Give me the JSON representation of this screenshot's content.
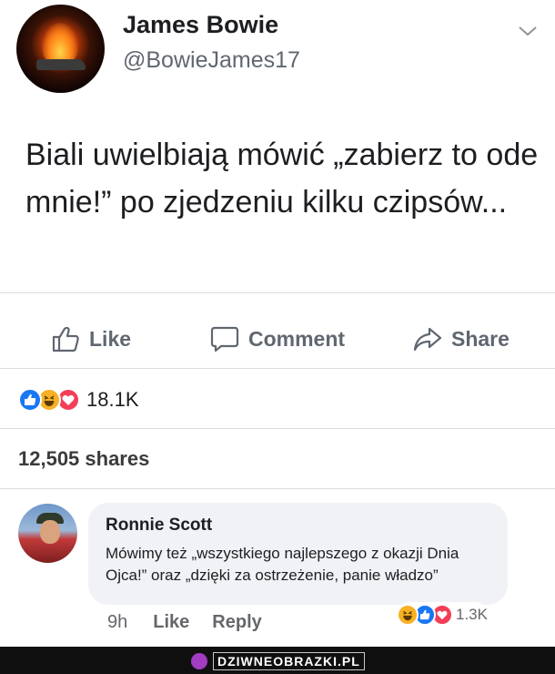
{
  "post": {
    "author_name": "James Bowie",
    "author_handle": "@BowieJames17",
    "text": "Biali uwielbiają mówić „zabierz to ode mnie!” po zjedzeniu kilku czipsów..."
  },
  "actions": {
    "like_label": "Like",
    "comment_label": "Comment",
    "share_label": "Share"
  },
  "stats": {
    "reaction_count": "18.1K",
    "shares": "12,505 shares"
  },
  "comment": {
    "author": "Ronnie Scott",
    "text": "Mówimy też „wszystkiego najlepszego z okazji Dnia Ojca!” oraz „dzięki za ostrzeżenie, panie władzo”",
    "time": "9h",
    "like_label": "Like",
    "reply_label": "Reply",
    "reaction_count": "1.3K"
  },
  "watermark": {
    "text": "DZIWNEOBRAZKI.PL"
  },
  "icons": {
    "menu": "chevron-down-icon",
    "like": "thumbs-up-icon",
    "comment": "comment-bubble-icon",
    "share": "share-arrow-icon",
    "reactions": [
      "like-reaction-icon",
      "haha-reaction-icon",
      "love-reaction-icon"
    ]
  },
  "colors": {
    "text_primary": "#1c1e21",
    "text_secondary": "#606770",
    "like_blue": "#1877f2",
    "haha_yellow": "#f7b125",
    "love_red": "#f33e58",
    "divider": "#dadde1",
    "comment_bg": "#f0f2f5"
  }
}
